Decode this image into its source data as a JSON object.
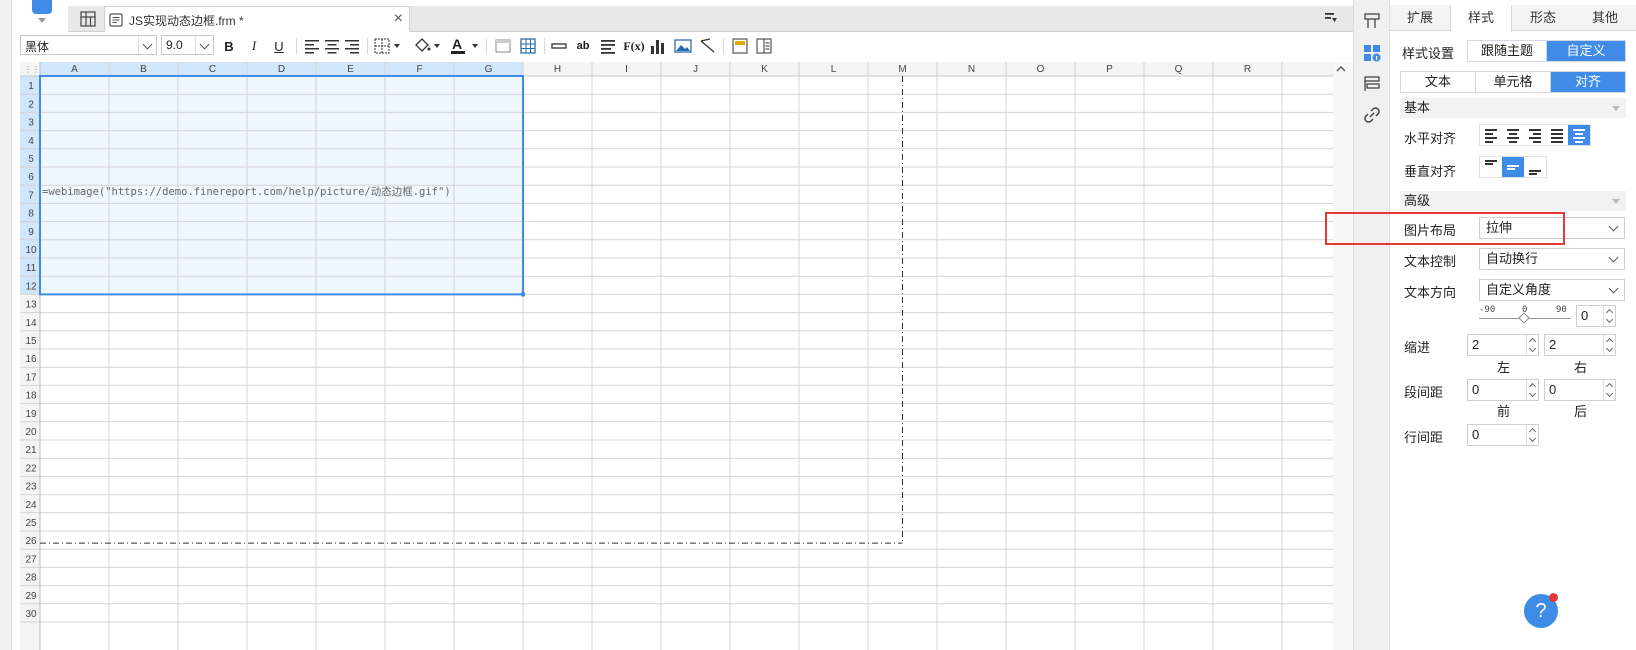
{
  "document_tab": {
    "title": "JS实现动态边框.frm *",
    "close_glyph": "×"
  },
  "toolbar": {
    "font_family": "黑体",
    "font_size": "9.0",
    "bold": "B",
    "italic": "I",
    "underline": "U",
    "text_sample": "ab",
    "formula_label": "F(x)"
  },
  "sheet": {
    "columns": [
      "A",
      "B",
      "C",
      "D",
      "E",
      "F",
      "G",
      "H",
      "I",
      "J",
      "K",
      "L",
      "M",
      "N",
      "O",
      "P",
      "Q",
      "R"
    ],
    "rows": [
      "1",
      "2",
      "3",
      "4",
      "5",
      "6",
      "7",
      "8",
      "9",
      "10",
      "11",
      "12",
      "13",
      "14",
      "15",
      "16",
      "17",
      "18",
      "19",
      "20",
      "21",
      "22",
      "23",
      "24",
      "25",
      "26",
      "27",
      "28",
      "29",
      "30"
    ],
    "selected_columns": [
      "A",
      "B",
      "C",
      "D",
      "E",
      "F",
      "G"
    ],
    "selected_rows": 12,
    "cell_formula": "=webimage(\"https://demo.finereport.com/help/picture/动态边框.gif\")"
  },
  "panel": {
    "tabs": [
      "扩展",
      "样式",
      "形态",
      "其他"
    ],
    "active_tab": "样式",
    "style_setting_label": "样式设置",
    "style_modes": [
      "跟随主题",
      "自定义"
    ],
    "sub_tabs": [
      "文本",
      "单元格",
      "对齐"
    ],
    "basic_section": "基本",
    "h_align_label": "水平对齐",
    "v_align_label": "垂直对齐",
    "advanced_section": "高级",
    "image_layout_label": "图片布局",
    "image_layout_value": "拉伸",
    "text_control_label": "文本控制",
    "text_control_value": "自动换行",
    "text_direction_label": "文本方向",
    "text_direction_value": "自定义角度",
    "slider_ticks": [
      "-90",
      "0",
      "90"
    ],
    "angle_value": "0",
    "indent_label": "缩进",
    "indent_left": "2",
    "indent_right": "2",
    "left_label": "左",
    "right_label": "右",
    "para_spacing_label": "段间距",
    "para_before": "0",
    "para_after": "0",
    "before_label": "前",
    "after_label": "后",
    "line_spacing_label": "行间距",
    "line_spacing": "0"
  },
  "help": {
    "glyph": "?"
  },
  "colors": {
    "accent": "#3f8ce8",
    "selection": "#eef6fe",
    "highlight": "#e53935"
  }
}
